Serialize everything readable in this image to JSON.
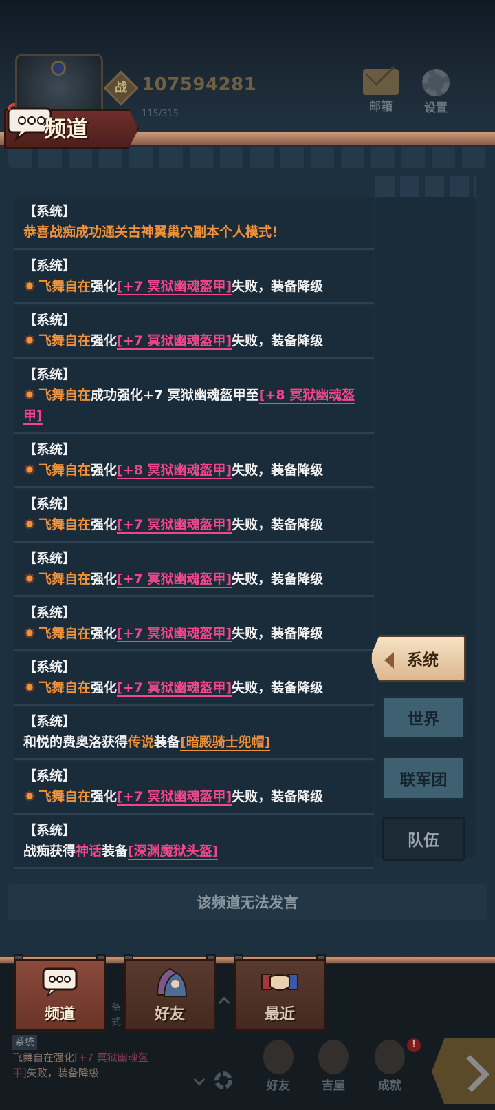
{
  "top": {
    "power_value": "107594281",
    "power_icon_char": "战",
    "stamina": "115/315",
    "mail_label": "邮箱",
    "settings_label": "设置"
  },
  "header": {
    "title": "频道"
  },
  "messages": [
    {
      "tag": "【系统】",
      "parts": [
        {
          "t": "恭喜战痴成功通关古神翼巢穴副本个人模式！",
          "c": "orange"
        }
      ]
    },
    {
      "tag": "【系统】",
      "parts": [
        {
          "t": "medal"
        },
        {
          "t": "飞舞自在",
          "c": "orange"
        },
        {
          "t": "强化"
        },
        {
          "t": "[+7 冥狱幽魂盔甲]",
          "c": "item"
        },
        {
          "t": "失败，装备降级"
        }
      ]
    },
    {
      "tag": "【系统】",
      "parts": [
        {
          "t": "medal"
        },
        {
          "t": "飞舞自在",
          "c": "orange"
        },
        {
          "t": "强化"
        },
        {
          "t": "[+7 冥狱幽魂盔甲]",
          "c": "item"
        },
        {
          "t": "失败，装备降级"
        }
      ]
    },
    {
      "tag": "【系统】",
      "parts": [
        {
          "t": "medal"
        },
        {
          "t": "飞舞自在",
          "c": "orange"
        },
        {
          "t": "成功强化+7 冥狱幽魂盔甲至"
        },
        {
          "t": "[+8 冥狱幽魂盔甲]",
          "c": "item"
        }
      ]
    },
    {
      "tag": "【系统】",
      "parts": [
        {
          "t": "medal"
        },
        {
          "t": "飞舞自在",
          "c": "orange"
        },
        {
          "t": "强化"
        },
        {
          "t": "[+8 冥狱幽魂盔甲]",
          "c": "item"
        },
        {
          "t": "失败，装备降级"
        }
      ]
    },
    {
      "tag": "【系统】",
      "parts": [
        {
          "t": "medal"
        },
        {
          "t": "飞舞自在",
          "c": "orange"
        },
        {
          "t": "强化"
        },
        {
          "t": "[+7 冥狱幽魂盔甲]",
          "c": "item"
        },
        {
          "t": "失败，装备降级"
        }
      ]
    },
    {
      "tag": "【系统】",
      "parts": [
        {
          "t": "medal"
        },
        {
          "t": "飞舞自在",
          "c": "orange"
        },
        {
          "t": "强化"
        },
        {
          "t": "[+7 冥狱幽魂盔甲]",
          "c": "item"
        },
        {
          "t": "失败，装备降级"
        }
      ]
    },
    {
      "tag": "【系统】",
      "parts": [
        {
          "t": "medal"
        },
        {
          "t": "飞舞自在",
          "c": "orange"
        },
        {
          "t": "强化"
        },
        {
          "t": "[+7 冥狱幽魂盔甲]",
          "c": "item"
        },
        {
          "t": "失败，装备降级"
        }
      ]
    },
    {
      "tag": "【系统】",
      "parts": [
        {
          "t": "medal"
        },
        {
          "t": "飞舞自在",
          "c": "orange"
        },
        {
          "t": "强化"
        },
        {
          "t": "[+7 冥狱幽魂盔甲]",
          "c": "item"
        },
        {
          "t": "失败，装备降级"
        }
      ]
    },
    {
      "tag": "【系统】",
      "parts": [
        {
          "t": "和悦的费奥洛获得"
        },
        {
          "t": "传说",
          "c": "orange"
        },
        {
          "t": "装备"
        },
        {
          "t": "[暗殿骑士兜帽]",
          "c": "item-orange"
        }
      ]
    },
    {
      "tag": "【系统】",
      "parts": [
        {
          "t": "medal"
        },
        {
          "t": "飞舞自在",
          "c": "orange"
        },
        {
          "t": "强化"
        },
        {
          "t": "[+7 冥狱幽魂盔甲]",
          "c": "item"
        },
        {
          "t": "失败，装备降级"
        }
      ]
    },
    {
      "tag": "【系统】",
      "parts": [
        {
          "t": "战痴获得"
        },
        {
          "t": "神话",
          "c": "pink"
        },
        {
          "t": "装备"
        },
        {
          "t": "[深渊魔狱头盔]",
          "c": "item"
        }
      ]
    }
  ],
  "side_tabs": {
    "system": "系统",
    "world": "世界",
    "legion": "联军团",
    "team": "队伍"
  },
  "input": {
    "disabled_text": "该频道无法发言"
  },
  "bottom_tabs": {
    "channel": "频道",
    "friends": "好友",
    "recent": "最近"
  },
  "hud": {
    "mini_tag": "系统",
    "mini_line1_name": "飞舞自在",
    "mini_line1_action": "强化",
    "mini_line1_item": "[+7 冥狱幽魂盔",
    "mini_line2_item": "甲]",
    "mini_line2_rest": "失败，装备降级",
    "side_text": "条式",
    "friends": "好友",
    "house": "吉屋",
    "achievement": "成就",
    "alert": "!"
  },
  "colors": {
    "orange": "#f0923a",
    "pink": "#f0478c",
    "panel": "#1d3040"
  }
}
